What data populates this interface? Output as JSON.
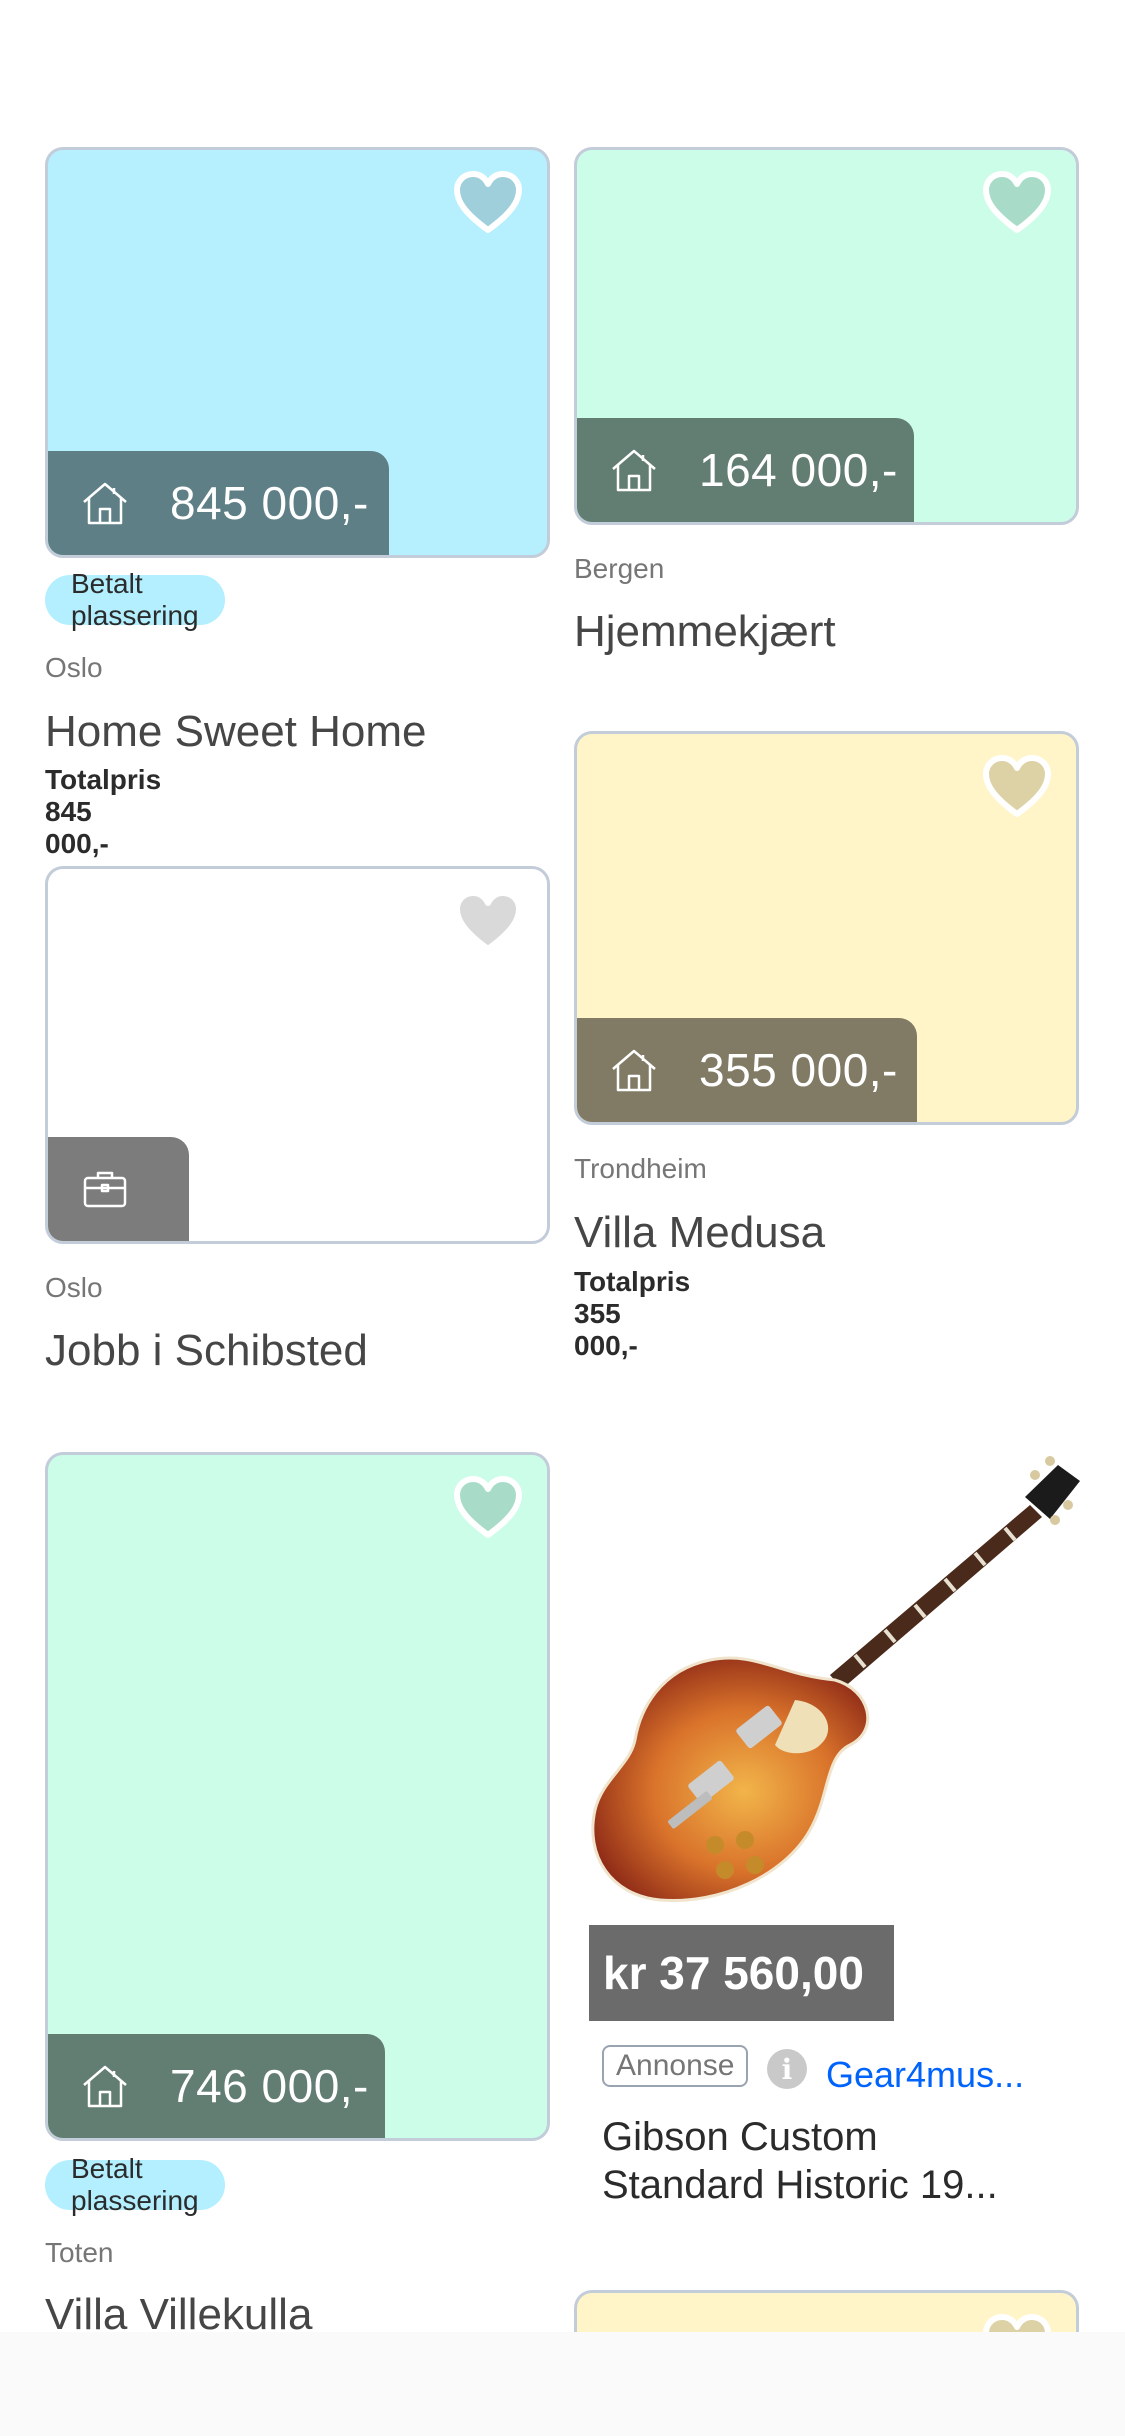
{
  "colors": {
    "sky": "#b6effe",
    "mint": "#ccfde9",
    "cream": "#fff5c8",
    "white": "#ffffff",
    "bar_blue": "#5e7f86",
    "bar_green": "#627d71",
    "bar_olive": "#817b65",
    "bar_gray": "#7c7c7c",
    "ad_blue": "#0063fb"
  },
  "listings": [
    {
      "id": "home-sweet-home",
      "icon": "house-icon",
      "price": "845 000,-",
      "badge": "Betalt plassering",
      "location": "Oslo",
      "title": "Home Sweet Home",
      "total": "Totalpris 845 000,-"
    },
    {
      "id": "hjemmekjaert",
      "icon": "house-icon",
      "price": "164 000,-",
      "location": "Bergen",
      "title": "Hjemmekjært"
    },
    {
      "id": "jobb-i-schibsted",
      "icon": "briefcase-icon",
      "location": "Oslo",
      "title": "Jobb i Schibsted"
    },
    {
      "id": "villa-medusa",
      "icon": "house-icon",
      "price": "355 000,-",
      "location": "Trondheim",
      "title": "Villa Medusa",
      "total": "Totalpris 355 000,-"
    },
    {
      "id": "villa-villekulla",
      "icon": "house-icon",
      "price": "746 000,-",
      "badge": "Betalt plassering",
      "location": "Toten",
      "title": "Villa Villekulla"
    }
  ],
  "ad": {
    "price": "kr 37 560,00",
    "tag": "Annonse",
    "info_icon": "info-icon",
    "seller": "Gear4mus...",
    "title": "Gibson Custom Standard Historic 19..."
  }
}
